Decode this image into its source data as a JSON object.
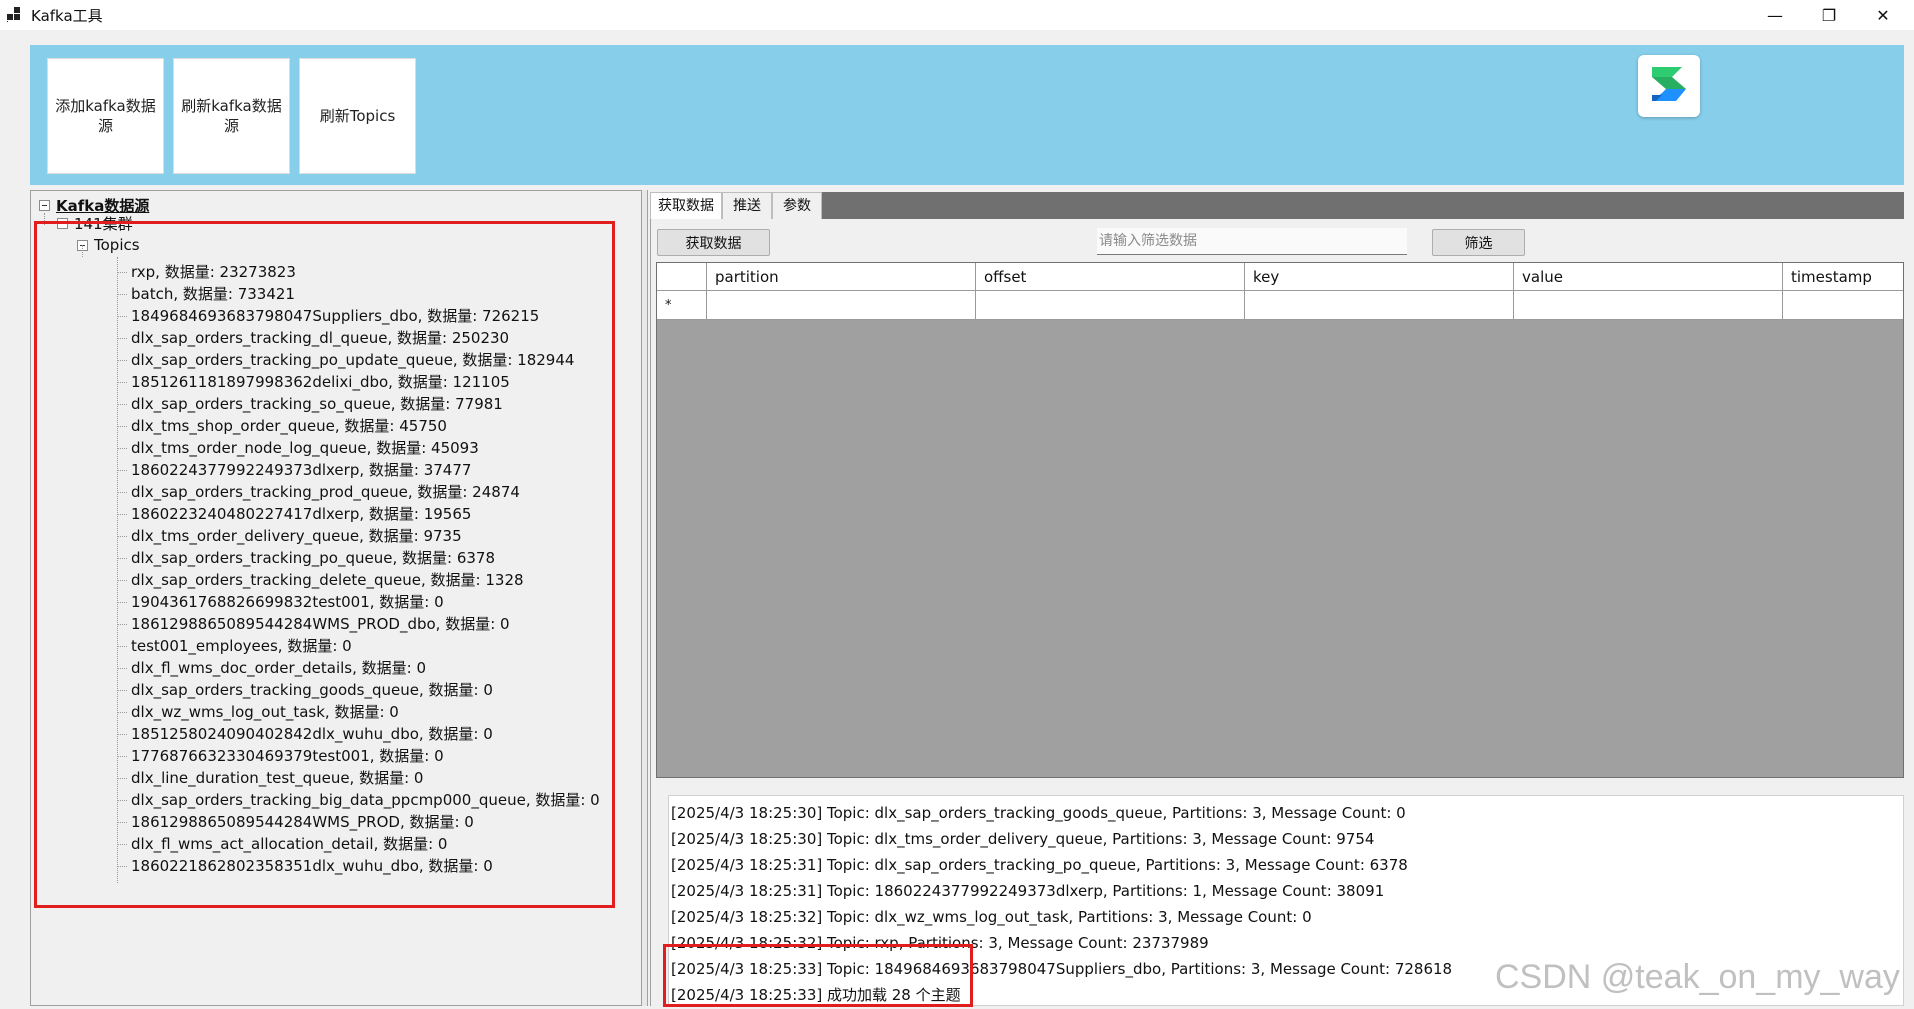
{
  "window": {
    "title": "Kafka工具",
    "controls": {
      "minimize": "—",
      "maximize": "❐",
      "close": "✕"
    }
  },
  "toolbar": {
    "add_source_label": "添加kafka数据源",
    "refresh_source_label": "刷新kafka数据源",
    "refresh_topics_label": "刷新Topics"
  },
  "tree": {
    "root_label": "Kafka数据源",
    "cluster_label": "141集群",
    "topics_label": "Topics",
    "topics": [
      "rxp, 数据量: 23273823",
      "batch, 数据量: 733421",
      "1849684693683798047Suppliers_dbo, 数据量: 726215",
      "dlx_sap_orders_tracking_dl_queue, 数据量: 250230",
      "dlx_sap_orders_tracking_po_update_queue, 数据量: 182944",
      "1851261181897998362delixi_dbo, 数据量: 121105",
      "dlx_sap_orders_tracking_so_queue, 数据量: 77981",
      "dlx_tms_shop_order_queue, 数据量: 45750",
      "dlx_tms_order_node_log_queue, 数据量: 45093",
      "1860224377992249373dlxerp, 数据量: 37477",
      "dlx_sap_orders_tracking_prod_queue, 数据量: 24874",
      "1860223240480227417dlxerp, 数据量: 19565",
      "dlx_tms_order_delivery_queue, 数据量: 9735",
      "dlx_sap_orders_tracking_po_queue, 数据量: 6378",
      "dlx_sap_orders_tracking_delete_queue, 数据量: 1328",
      "1904361768826699832test001, 数据量: 0",
      "1861298865089544284WMS_PROD_dbo, 数据量: 0",
      "test001_employees, 数据量: 0",
      "dlx_fl_wms_doc_order_details, 数据量: 0",
      "dlx_sap_orders_tracking_goods_queue, 数据量: 0",
      "dlx_wz_wms_log_out_task, 数据量: 0",
      "1851258024090402842dlx_wuhu_dbo, 数据量: 0",
      "1776876632330469379test001, 数据量: 0",
      "dlx_line_duration_test_queue, 数据量: 0",
      "dlx_sap_orders_tracking_big_data_ppcmp000_queue, 数据量: 0",
      "1861298865089544284WMS_PROD, 数据量: 0",
      "dlx_fl_wms_act_allocation_detail, 数据量: 0",
      "1860221862802358351dlx_wuhu_dbo, 数据量: 0"
    ]
  },
  "tabs": [
    {
      "label": "获取数据"
    },
    {
      "label": "推送"
    },
    {
      "label": "参数"
    }
  ],
  "fetch": {
    "fetch_button_label": "获取数据",
    "filter_placeholder": "请输入筛选数据",
    "filter_button_label": "筛选"
  },
  "grid": {
    "columns": [
      "partition",
      "offset",
      "key",
      "value",
      "timestamp"
    ],
    "new_row_marker": "*"
  },
  "log": [
    "[2025/4/3 18:25:30] Topic: dlx_sap_orders_tracking_goods_queue, Partitions: 3, Message Count: 0",
    "[2025/4/3 18:25:30] Topic: dlx_tms_order_delivery_queue, Partitions: 3, Message Count: 9754",
    "[2025/4/3 18:25:31] Topic: dlx_sap_orders_tracking_po_queue, Partitions: 3, Message Count: 6378",
    "[2025/4/3 18:25:31] Topic: 1860224377992249373dlxerp, Partitions: 1, Message Count: 38091",
    "[2025/4/3 18:25:32] Topic: dlx_wz_wms_log_out_task, Partitions: 3, Message Count: 0",
    "[2025/4/3 18:25:32] Topic: rxp, Partitions: 3, Message Count: 23737989",
    "[2025/4/3 18:25:33] Topic: 1849684693683798047Suppliers_dbo, Partitions: 3, Message Count: 728618",
    "[2025/4/3 18:25:33] 成功加载 28 个主题"
  ],
  "watermark": "CSDN @teak_on_my_way",
  "colors": {
    "toolbar_bg": "#87ceeb",
    "highlight_box": "#e01e1e",
    "grid_bg": "#a0a0a0"
  },
  "icons": {
    "app": "app-grid-icon",
    "logo": "brand-logo-icon"
  }
}
